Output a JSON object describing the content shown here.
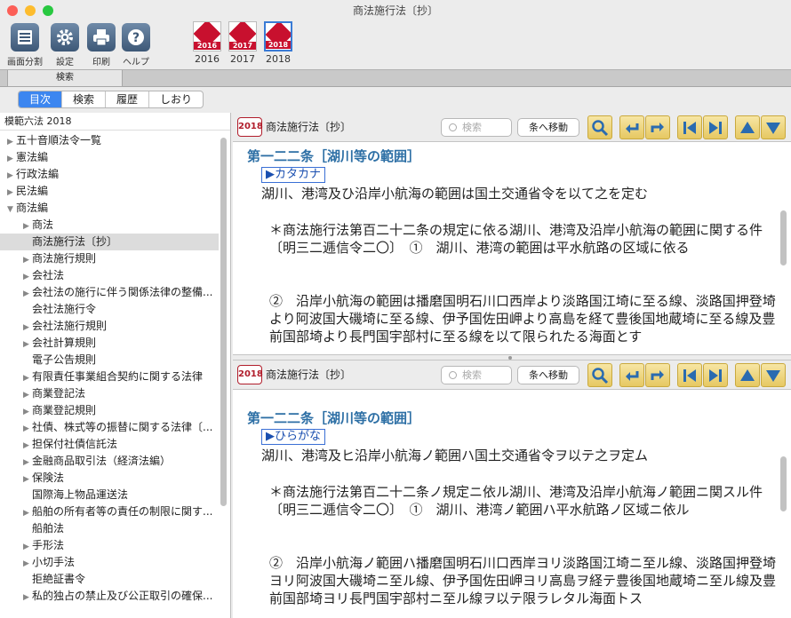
{
  "window": {
    "title": "商法施行法〔抄〕"
  },
  "toolbar": {
    "tools": [
      {
        "label": "画面分割",
        "icon": "split-screen-icon"
      },
      {
        "label": "設定",
        "icon": "gear-icon"
      },
      {
        "label": "印刷",
        "icon": "printer-icon"
      },
      {
        "label": "ヘルプ",
        "icon": "help-icon"
      }
    ],
    "editions": [
      {
        "label": "2016",
        "cover": "模範六法 2016"
      },
      {
        "label": "2017",
        "cover": "模範六法 2017"
      },
      {
        "label": "2018",
        "cover": "模範六法 2018"
      }
    ]
  },
  "search_tab": "検索",
  "segments": [
    "目次",
    "検索",
    "履歴",
    "しおり"
  ],
  "sidebar": {
    "header": "模範六法 2018",
    "items": [
      {
        "label": "五十音順法令一覧",
        "level": 0,
        "arrow": "▶"
      },
      {
        "label": "憲法編",
        "level": 0,
        "arrow": "▶"
      },
      {
        "label": "行政法編",
        "level": 0,
        "arrow": "▶"
      },
      {
        "label": "民法編",
        "level": 0,
        "arrow": "▶"
      },
      {
        "label": "商法編",
        "level": 0,
        "arrow": "▼"
      },
      {
        "label": "商法",
        "level": 1,
        "arrow": "▶"
      },
      {
        "label": "商法施行法〔抄〕",
        "level": 1,
        "arrow": "",
        "selected": true
      },
      {
        "label": "商法施行規則",
        "level": 1,
        "arrow": "▶"
      },
      {
        "label": "会社法",
        "level": 1,
        "arrow": "▶"
      },
      {
        "label": "会社法の施行に伴う関係法律の整備...",
        "level": 1,
        "arrow": "▶"
      },
      {
        "label": "会社法施行令",
        "level": 1,
        "arrow": ""
      },
      {
        "label": "会社法施行規則",
        "level": 1,
        "arrow": "▶"
      },
      {
        "label": "会社計算規則",
        "level": 1,
        "arrow": "▶"
      },
      {
        "label": "電子公告規則",
        "level": 1,
        "arrow": ""
      },
      {
        "label": "有限責任事業組合契約に関する法律",
        "level": 1,
        "arrow": "▶"
      },
      {
        "label": "商業登記法",
        "level": 1,
        "arrow": "▶"
      },
      {
        "label": "商業登記規則",
        "level": 1,
        "arrow": "▶"
      },
      {
        "label": "社債、株式等の振替に関する法律〔...",
        "level": 1,
        "arrow": "▶"
      },
      {
        "label": "担保付社債信託法",
        "level": 1,
        "arrow": "▶"
      },
      {
        "label": "金融商品取引法（経済法編）",
        "level": 1,
        "arrow": "▶"
      },
      {
        "label": "保険法",
        "level": 1,
        "arrow": "▶"
      },
      {
        "label": "国際海上物品運送法",
        "level": 1,
        "arrow": ""
      },
      {
        "label": "船舶の所有者等の責任の制限に関す...",
        "level": 1,
        "arrow": "▶"
      },
      {
        "label": "船舶法",
        "level": 1,
        "arrow": ""
      },
      {
        "label": "手形法",
        "level": 1,
        "arrow": "▶"
      },
      {
        "label": "小切手法",
        "level": 1,
        "arrow": "▶"
      },
      {
        "label": "拒絶証書令",
        "level": 1,
        "arrow": ""
      },
      {
        "label": "私的独占の禁止及び公正取引の確保...",
        "level": 1,
        "arrow": "▶"
      }
    ]
  },
  "panes": [
    {
      "year": "2018",
      "title": "商法施行法〔抄〕",
      "search_placeholder": "検索",
      "jump_label": "条へ移動",
      "article": "第一二二条［湖川等の範囲］",
      "script_tag": "▶カタカナ",
      "text1": "湖川、港湾及ひ沿岸小航海の範囲は国土交通省令を以て之を定む",
      "para1": "＊商法施行法第百二十二条の規定に依る湖川、港湾及沿岸小航海の範囲に関する件〔明三二逓信令二〇〕　①　湖川、港湾の範囲は平水航路の区域に依る",
      "para2": "②　沿岸小航海の範囲は播磨国明石川口西岸より淡路国江埼に至る線、淡路国押登埼より阿波国大磯埼に至る線、伊予国佐田岬より高島を経て豊後国地蔵埼に至る線及豊前国部埼より長門国宇部村に至る線を以て限られたる海面とす"
    },
    {
      "year": "2018",
      "title": "商法施行法〔抄〕",
      "search_placeholder": "検索",
      "jump_label": "条へ移動",
      "article": "第一二二条［湖川等の範囲］",
      "script_tag": "▶ひらがな",
      "text1": "湖川、港湾及ヒ沿岸小航海ノ範囲ハ国土交通省令ヲ以テ之ヲ定ム",
      "para1": "＊商法施行法第百二十二条ノ規定ニ依ル湖川、港湾及沿岸小航海ノ範囲ニ関スル件〔明三二逓信令二〇〕　①　湖川、港湾ノ範囲ハ平水航路ノ区域ニ依ル",
      "para2": "②　沿岸小航海ノ範囲ハ播磨国明石川口西岸ヨリ淡路国江埼ニ至ル線、淡路国押登埼ヨリ阿波国大磯埼ニ至ル線、伊予国佐田岬ヨリ高島ヲ経テ豊後国地蔵埼ニ至ル線及豊前国部埼ヨリ長門国宇部村ニ至ル線ヲ以テ限ラレタル海面トス"
    }
  ]
}
